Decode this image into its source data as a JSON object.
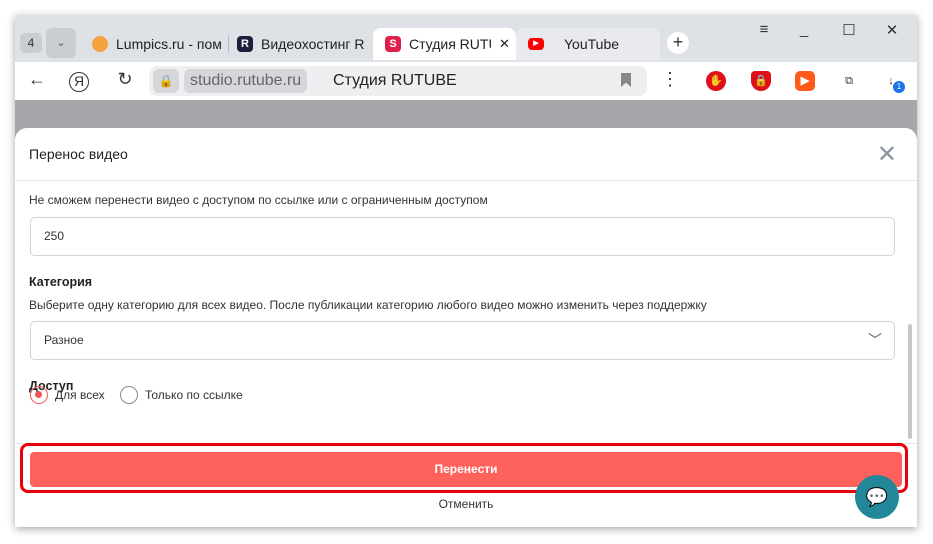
{
  "browser": {
    "tab_count": "4",
    "tabs": [
      {
        "label": "Lumpics.ru - пом",
        "icon": "orange-icon",
        "color": "#f7a23b"
      },
      {
        "label": "Видеохостинг R",
        "icon": "rutube-icon",
        "color": "#1d1e3c"
      },
      {
        "label": "Студия RUTUBE",
        "icon": "rutube-studio-icon",
        "color": "#e0204a",
        "active": true
      },
      {
        "label": "YouTube",
        "icon": "youtube-icon",
        "color": "#ff0000"
      }
    ],
    "domain": "studio.rutube.ru",
    "page_title": "Студия RUTUBE",
    "download_badge": "1"
  },
  "modal": {
    "title": "Перенос видео",
    "restriction_note": "Не сможем перенести видео с доступом по ссылке или с ограниченным доступом",
    "count_value": "250",
    "category_label": "Категория",
    "category_hint": "Выберите одну категорию для всех видео. После публикации категорию любого видео можно изменить через поддержку",
    "category_value": "Разное",
    "access_label": "Доступ",
    "access_options": [
      {
        "label": "Для всех",
        "selected": true
      },
      {
        "label": "Только по ссылке",
        "selected": false
      }
    ],
    "submit_label": "Перенести",
    "cancel_label": "Отменить"
  },
  "colors": {
    "accent": "#ff625d",
    "highlight": "#e8000b",
    "chat": "#23879a"
  }
}
